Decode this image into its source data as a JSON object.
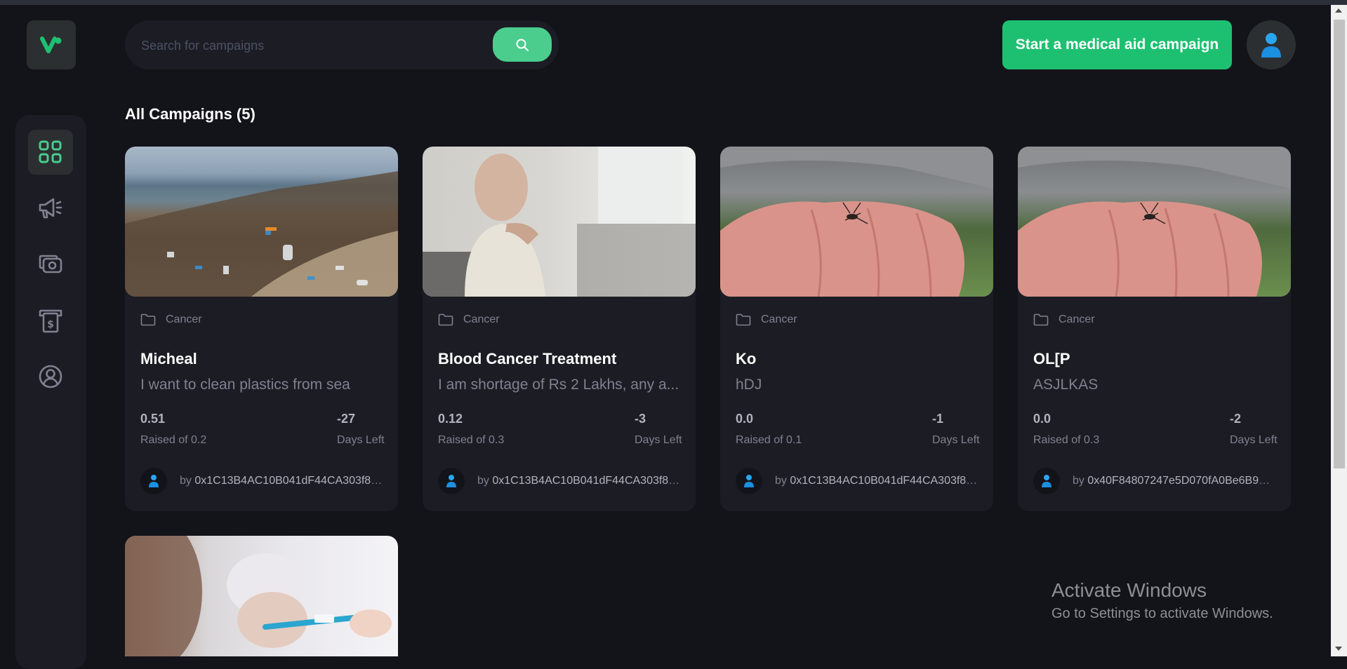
{
  "colors": {
    "background": "#13131a",
    "panel": "#1c1c24",
    "accent": "#1dc071",
    "search_button": "#4acd8d",
    "active_icon": "#4acd8d",
    "inactive_icon": "#808191"
  },
  "search": {
    "placeholder": "Search for campaigns",
    "value": ""
  },
  "header": {
    "create_label": "Start a medical aid campaign"
  },
  "sidebar": {
    "items": [
      {
        "icon": "dashboard-icon",
        "active": true
      },
      {
        "icon": "campaign-icon",
        "active": false
      },
      {
        "icon": "payment-icon",
        "active": false
      },
      {
        "icon": "withdraw-icon",
        "active": false
      },
      {
        "icon": "profile-icon",
        "active": false
      }
    ]
  },
  "section": {
    "title": "All Campaigns (5)"
  },
  "campaigns": [
    {
      "category": "Cancer",
      "title": "Micheal",
      "description": "I want to clean plastics from sea",
      "raised": "0.51",
      "raised_label": "Raised of 0.2",
      "days": "-27",
      "days_label": "Days Left",
      "by_label": "by",
      "owner": "0x1C13B4AC10B041dF44CA303f83..."
    },
    {
      "category": "Cancer",
      "title": "Blood Cancer Treatment",
      "description": "I am shortage of Rs 2 Lakhs, any a...",
      "raised": "0.12",
      "raised_label": "Raised of 0.3",
      "days": "-3",
      "days_label": "Days Left",
      "by_label": "by",
      "owner": "0x1C13B4AC10B041dF44CA303f83..."
    },
    {
      "category": "Cancer",
      "title": "Ko",
      "description": "hDJ",
      "raised": "0.0",
      "raised_label": "Raised of 0.1",
      "days": "-1",
      "days_label": "Days Left",
      "by_label": "by",
      "owner": "0x1C13B4AC10B041dF44CA303f83..."
    },
    {
      "category": "Cancer",
      "title": "OL[P",
      "description": "ASJLKAS",
      "raised": "0.0",
      "raised_label": "Raised of 0.3",
      "days": "-2",
      "days_label": "Days Left",
      "by_label": "by",
      "owner": "0x40F84807247e5D070fA0Be6B91D..."
    }
  ],
  "watermark": {
    "line1": "Activate Windows",
    "line2": "Go to Settings to activate Windows."
  }
}
